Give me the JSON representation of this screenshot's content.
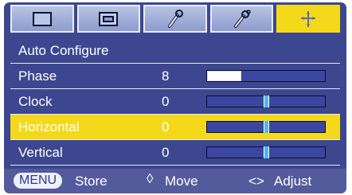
{
  "tabs": [
    {
      "icon": "picture-icon",
      "active": false
    },
    {
      "icon": "screen-icon",
      "active": false
    },
    {
      "icon": "tools-icon",
      "active": false
    },
    {
      "icon": "special-tools-icon",
      "active": false
    },
    {
      "icon": "position-icon",
      "active": true
    }
  ],
  "menu": {
    "auto_configure": {
      "label": "Auto Configure"
    },
    "items": [
      {
        "label": "Phase",
        "value": "8",
        "level": 0.29,
        "selected": false
      },
      {
        "label": "Clock",
        "value": "0",
        "level": 0.5,
        "selected": false
      },
      {
        "label": "Horizontal",
        "value": "0",
        "level": 0.5,
        "selected": true
      },
      {
        "label": "Vertical",
        "value": "0",
        "level": 0.5,
        "selected": false
      }
    ]
  },
  "footer": {
    "menu_key": "MENU",
    "store": "Store",
    "updown_symbol": "◊",
    "move": "Move",
    "lr_symbol": "<>",
    "adjust": "Adjust"
  },
  "colors": {
    "background": "#3c478f",
    "highlight": "#f4d91a",
    "tab": "#a3b2dc",
    "bar": "#3b46a0",
    "marker": "#4fb8ef",
    "footer": "#535b9d"
  }
}
